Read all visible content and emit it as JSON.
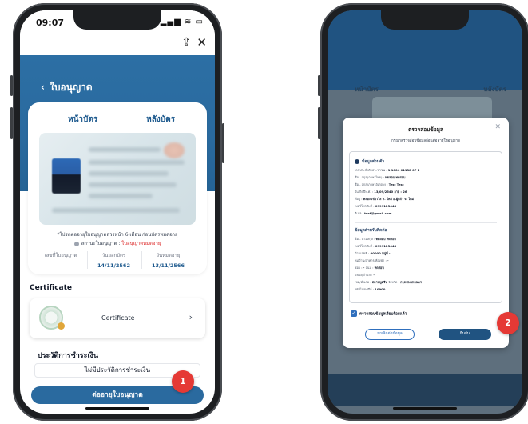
{
  "left_screen": {
    "status_time": "09:07",
    "status_icons": "▂▄▆ ≋ ▭",
    "share_icon": "share-icon",
    "close_icon": "close-icon",
    "back_label": "ใบอนุญาต",
    "tabs": {
      "front": "หน้าบัตร",
      "back": "หลังบัตร"
    },
    "renew_note": "*โปรดต่ออายุใบอนุญาตล่วงหน้า 6 เดือน ก่อนบัตรหมดอายุ",
    "status_label": "สถานะใบอนุญาต : ",
    "status_value": "ใบอนุญาตหมดอายุ",
    "dates": {
      "license_label": "เลขที่ใบอนุญาต",
      "issue_label": "วันออกบัตร",
      "issue_value": "14/11/2562",
      "expire_label": "วันหมดอายุ",
      "expire_value": "13/11/2566"
    },
    "certificate_title": "Certificate",
    "certificate_item": "Certificate",
    "payment_title": "ประวัติการชำระเงิน",
    "payment_empty": "ไม่มีประวัติการชำระเงิน",
    "renew_button": "ต่ออายุใบอนุญาต",
    "step_badge": "1"
  },
  "right_screen": {
    "bg_tabs": {
      "front": "หน้าบัตร",
      "back": "หลังบัตร"
    },
    "modal": {
      "title": "ตรวจสอบข้อมูล",
      "subtitle": "กรุณาตรวจสอบข้อมูลก่อนต่ออายุใบอนุญาต",
      "personal_section": "ข้อมูลส่วนตัว",
      "personal_lines": [
        {
          "label": "เลขประจำตัวประชาชน : ",
          "value": "1 1004 01138 07 2"
        },
        {
          "label": "ชื่อ - สกุล(ภาษาไทย) : ",
          "value": "ทดสอบ ทดสอบ"
        },
        {
          "label": "ชื่อ - สกุล(ภาษาอังกฤษ) : ",
          "value": "Test Test"
        },
        {
          "label": "วันเกิดปีพ.ศ. : ",
          "value": "13/09/2540 อายุ : 26"
        },
        {
          "label": "ที่อยู่ : ",
          "value": "คลอง เขียวใส ต. ใหม่ อ.ผู้กล้า จ. ใหม่"
        },
        {
          "label": "เบอร์โทรศัพท์ : ",
          "value": "0999123448"
        },
        {
          "label": "อีเมล : ",
          "value": "test@gmail.com"
        }
      ],
      "contact_section": "ข้อมูลสำหรับติดต่อ",
      "contact_lines": [
        {
          "label": "ชื่อ - นามสกุล : ",
          "value": "ทดสอบ ทดสอบ"
        },
        {
          "label": "เบอร์โทรศัพท์ : ",
          "value": "0999123448"
        },
        {
          "label": "บ้านเลขที่ : ",
          "value": "00000 หมู่ที่ -"
        },
        {
          "label": "หมู่บ้าน/อาคาร/ห้องพัก : ",
          "value": "-"
        },
        {
          "label": "ซอย : ",
          "value": "-"
        },
        {
          "label": "ถนน : ",
          "value": "ทดสอบ"
        },
        {
          "label": "แขวง/ตำบล : ",
          "value": "-"
        },
        {
          "label": "เขต/อำเภอ : ",
          "value": "สถานทูตจีน"
        },
        {
          "label": "จังหวัด : ",
          "value": "กรุงเทพมหานคร"
        },
        {
          "label": "รหัสไปรษณีย์ : ",
          "value": "10900"
        }
      ],
      "consent_text": "ตรวจสอบข้อมูลเรียบร้อยแล้ว",
      "cancel_button": "ยกเลิกต่อข้อมูล",
      "confirm_button": "ยืนยัน"
    },
    "step_badge": "2"
  },
  "colors": {
    "primary": "#2a6a9f",
    "dark_primary": "#205381",
    "badge": "#e53935",
    "expired": "#dc2626",
    "checkbox": "#2f6fbd"
  }
}
